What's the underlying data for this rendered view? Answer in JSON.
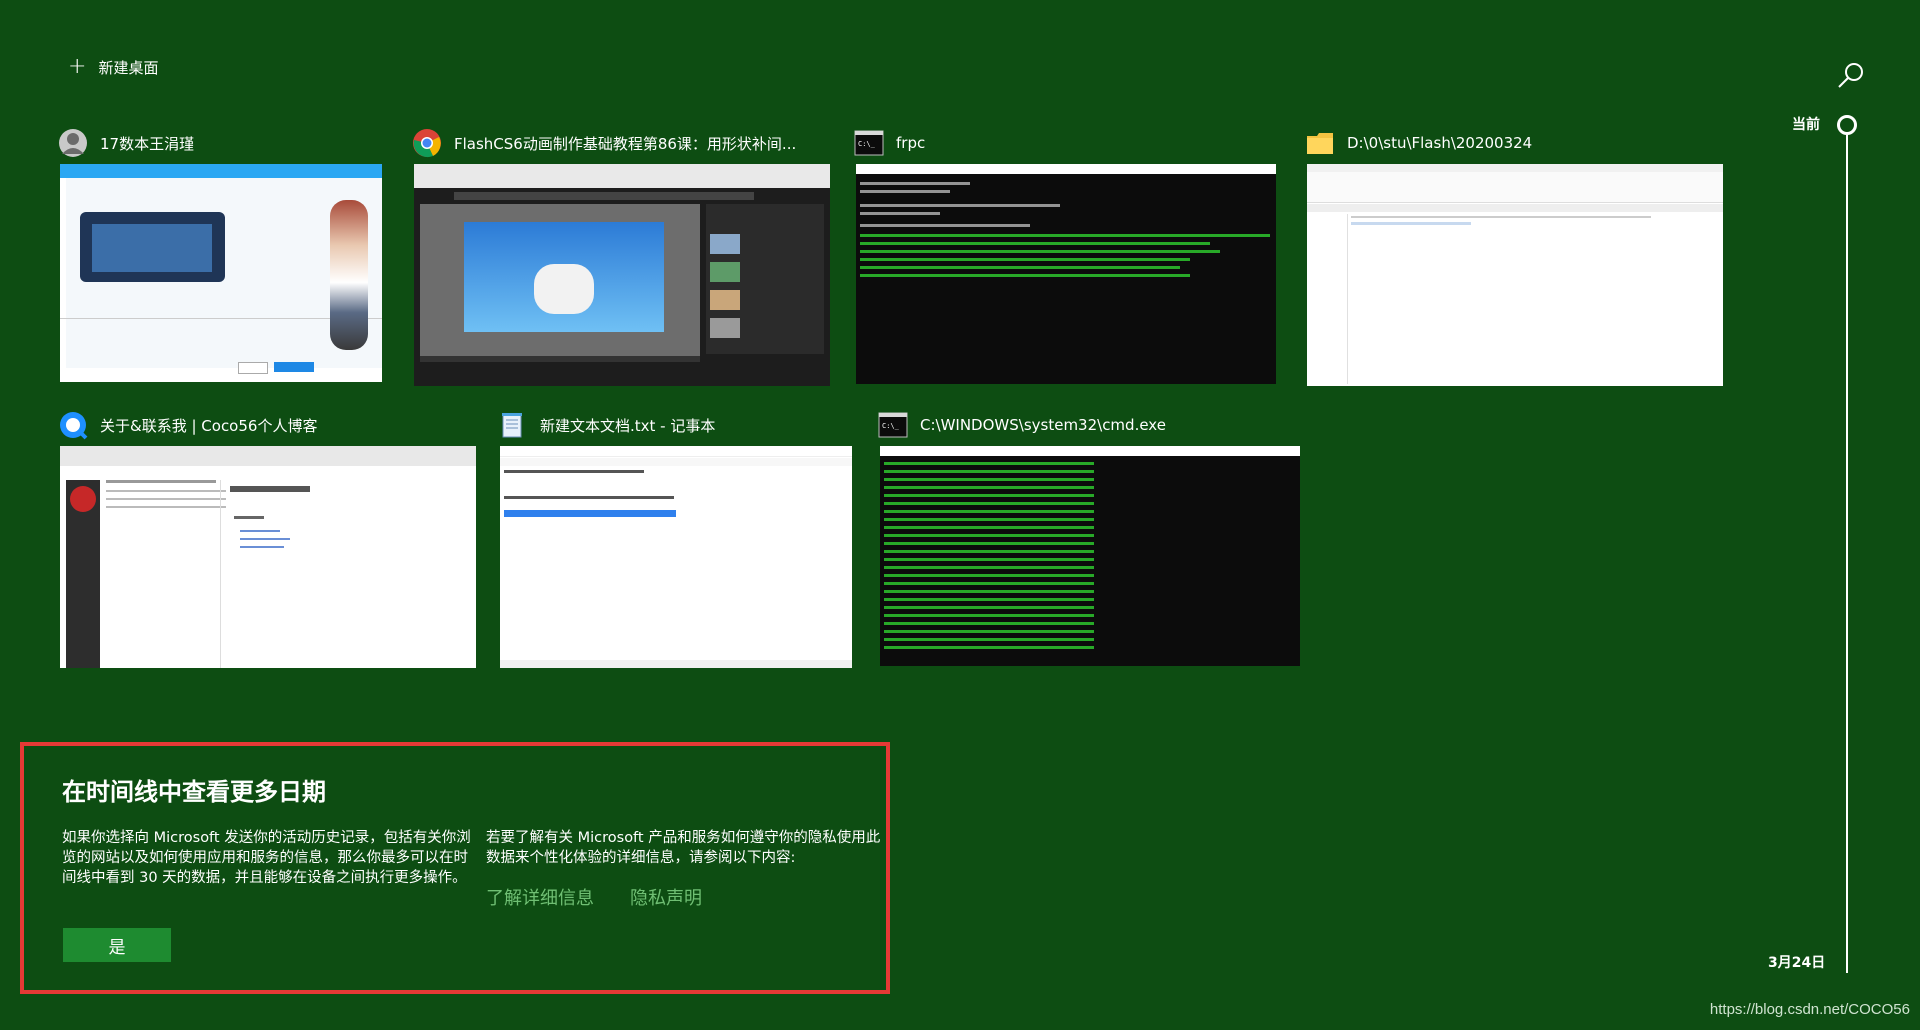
{
  "header": {
    "new_desktop_label": "新建桌面",
    "search_icon": "search-icon"
  },
  "windows": [
    {
      "title": "17数本王涓瑾",
      "icon": "user-avatar-icon"
    },
    {
      "title": "FlashCS6动画制作基础教程第86课：用形状补间...",
      "icon": "chrome-icon"
    },
    {
      "title": "frpc",
      "icon": "terminal-icon"
    },
    {
      "title": "D:\\0\\stu\\Flash\\20200324",
      "icon": "folder-icon"
    },
    {
      "title": "关于&联系我 | Coco56个人博客",
      "icon": "qq-browser-icon"
    },
    {
      "title": "新建文本文档.txt - 记事本",
      "icon": "notepad-icon"
    },
    {
      "title": "C:\\WINDOWS\\system32\\cmd.exe",
      "icon": "terminal-icon"
    }
  ],
  "timeline": {
    "current_label": "当前",
    "date_label": "3月24日"
  },
  "promo": {
    "heading": "在时间线中查看更多日期",
    "body_left": "如果你选择向 Microsoft 发送你的活动历史记录，包括有关你浏览的网站以及如何使用应用和服务的信息，那么你最多可以在时间线中看到 30 天的数据，并且能够在设备之间执行更多操作。",
    "body_right": "若要了解有关 Microsoft 产品和服务如何遵守你的隐私使用此数据来个性化体验的详细信息，请参阅以下内容:",
    "link_learn_more": "了解详细信息",
    "link_privacy": "隐私声明",
    "yes_button": "是"
  },
  "watermark": "https://blog.csdn.net/COCO56",
  "colors": {
    "background": "#0d4d12",
    "accent_button": "#1e8b30",
    "link": "#6fbf73",
    "highlight_border": "#e53935"
  }
}
